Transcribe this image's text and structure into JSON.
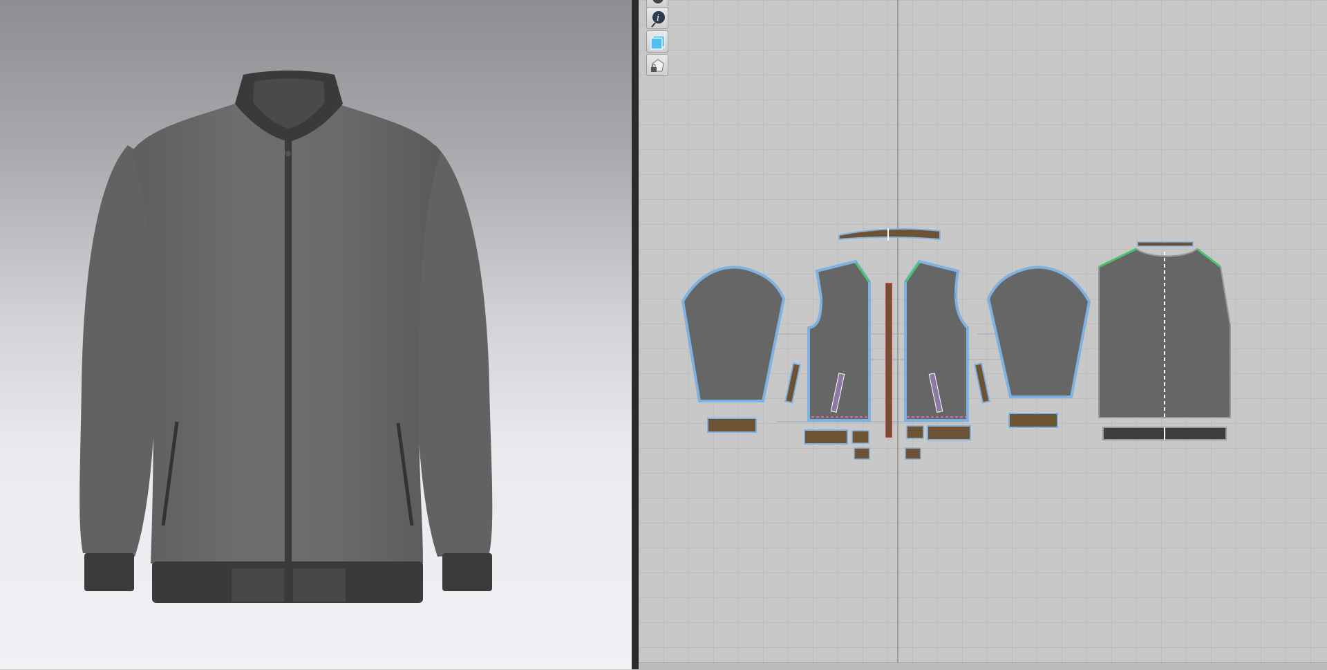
{
  "app": {
    "panels": {
      "view3d": "3d-garment-viewport",
      "view2d": "2d-pattern-viewport"
    }
  },
  "toolbar": {
    "tools": [
      {
        "icon": "settings-icon"
      },
      {
        "icon": "info-icon"
      },
      {
        "icon": "texture-icon"
      },
      {
        "icon": "lock-garment-icon"
      }
    ]
  },
  "colors": {
    "fabric": "#666666",
    "rib": "#3d3d3d",
    "seam_outline": "#7fb2e0",
    "trim_piece": "#6e5234",
    "grid": "#bdbdbd",
    "background_2d": "#c8c8c8"
  },
  "pattern_pieces": [
    "left-sleeve",
    "left-front",
    "zipper-strip",
    "right-front",
    "right-sleeve",
    "back",
    "collar",
    "back-yoke-binding",
    "left-cuff",
    "right-cuff",
    "left-hem-band",
    "right-hem-band",
    "back-hem-band",
    "left-welt",
    "right-welt",
    "pocket-bag-1",
    "pocket-bag-2",
    "pocket-bag-3",
    "pocket-bag-4"
  ]
}
